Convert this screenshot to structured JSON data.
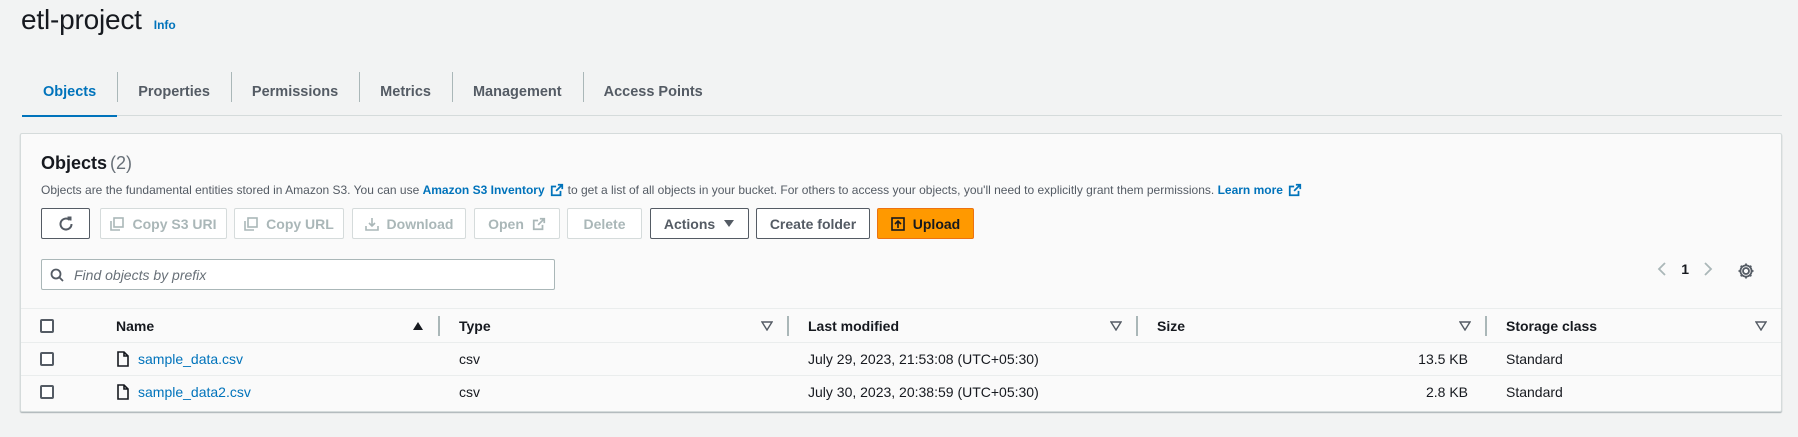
{
  "header": {
    "title": "etl-project",
    "info_label": "Info"
  },
  "tabs": [
    {
      "label": "Objects",
      "active": true
    },
    {
      "label": "Properties"
    },
    {
      "label": "Permissions"
    },
    {
      "label": "Metrics"
    },
    {
      "label": "Management"
    },
    {
      "label": "Access Points"
    }
  ],
  "panel": {
    "title": "Objects",
    "count": "(2)",
    "description": {
      "text_before": "Objects are the fundamental entities stored in Amazon S3. You can use",
      "inventory_link": "Amazon S3 Inventory",
      "text_after": "to get a list of all objects in your bucket. For others to access your objects, you'll need to explicitly grant them permissions.",
      "learn_more": "Learn more"
    }
  },
  "toolbar": {
    "copy_s3_uri": "Copy S3 URI",
    "copy_url": "Copy URL",
    "download": "Download",
    "open": "Open",
    "delete": "Delete",
    "actions": "Actions",
    "create_folder": "Create folder",
    "upload": "Upload"
  },
  "search": {
    "placeholder": "Find objects by prefix",
    "value": ""
  },
  "pagination": {
    "current_page": "1"
  },
  "table": {
    "columns": [
      "Name",
      "Type",
      "Last modified",
      "Size",
      "Storage class"
    ],
    "rows": [
      {
        "name": "sample_data.csv",
        "type": "csv",
        "modified": "July 29, 2023, 21:53:08 (UTC+05:30)",
        "size": "13.5 KB",
        "storage_class": "Standard"
      },
      {
        "name": "sample_data2.csv",
        "type": "csv",
        "modified": "July 30, 2023, 20:38:59 (UTC+05:30)",
        "size": "2.8 KB",
        "storage_class": "Standard"
      }
    ]
  },
  "colors": {
    "link": "#0073bb",
    "primary": "#ff9900",
    "text": "#16191f",
    "muted": "#545b64"
  }
}
